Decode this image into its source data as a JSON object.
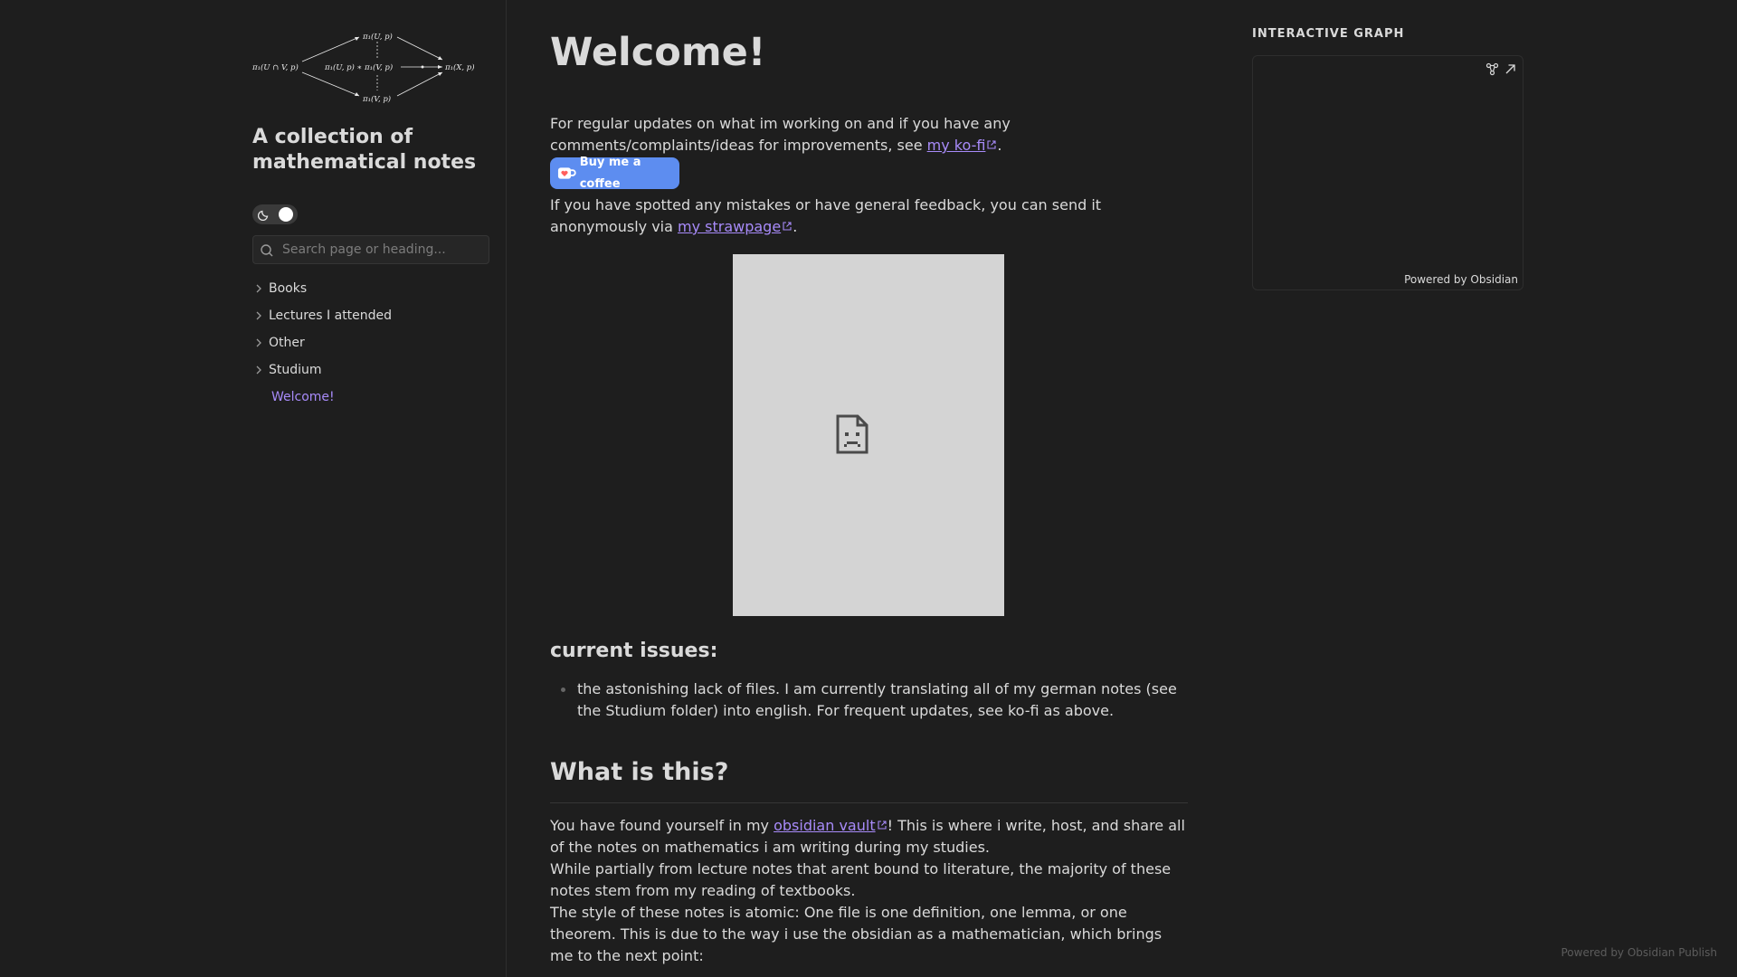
{
  "sidebar": {
    "site_name": "A collection of mathematical notes",
    "logo_labels": {
      "top": "π₁(U, p)",
      "left": "π₁(U ∩ V, p)",
      "middle": "π₁(U, p) ∗ π₁(V, p)",
      "right": "π₁(X, p)",
      "bottom": "π₁(V, p)"
    },
    "search": {
      "placeholder": "Search page or heading..."
    },
    "nav": [
      {
        "label": "Books"
      },
      {
        "label": "Lectures I attended"
      },
      {
        "label": "Other"
      },
      {
        "label": "Studium"
      }
    ],
    "active_page": "Welcome!"
  },
  "main": {
    "title": "Welcome!",
    "intro": {
      "text1": "For regular updates on what im working on and if you have any comments/complaints/ideas for improvements, see ",
      "link": "my ko-fi",
      "text2": "."
    },
    "kofi_button": "Buy me a coffee",
    "feedback": {
      "text1": "If you have spotted any mistakes or have general feedback, you can send it anonymously via ",
      "link": "my strawpage",
      "text2": "."
    },
    "issues_heading": "current issues:",
    "issues": [
      "the astonishing lack of files. I am currently translating all of my german notes (see the Studium folder) into english. For frequent updates, see ko-fi as above."
    ],
    "what_heading": "What is this?",
    "what_text": {
      "text1": "You have found yourself in my ",
      "link": "obsidian vault",
      "text2": "! This is where i write, host, and share all of the notes on mathematics i am writing during my studies.",
      "line2": "While partially from lecture notes that arent bound to literature, the majority of these notes stem from my reading of textbooks.",
      "line3": "The style of these notes is atomic: One file is one definition, one lemma, or one theorem. This is due to the way i use the obsidian as a mathematician, which brings me to the next point:"
    }
  },
  "graph": {
    "heading": "INTERACTIVE GRAPH",
    "powered_by": "Powered by Obsidian",
    "icons": [
      "graph-icon",
      "expand-icon"
    ]
  },
  "footer": {
    "credit": "Powered by Obsidian Publish"
  },
  "colors": {
    "background": "#1e1e1e",
    "text": "#dadada",
    "accent": "#a88bfa",
    "kofi_blue": "#5d8df0"
  }
}
